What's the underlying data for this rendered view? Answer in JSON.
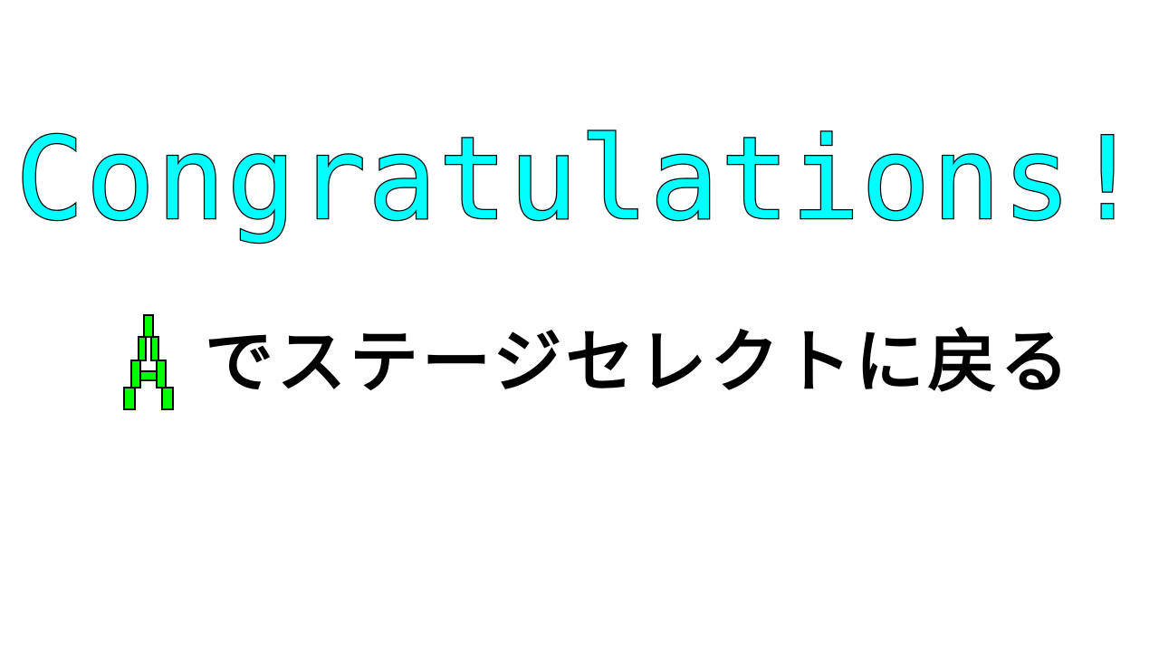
{
  "title": {
    "text": "Congratulations!",
    "color": "#00ffff",
    "outline_color": "#000000"
  },
  "prompt": {
    "button_icon": "a-button-icon",
    "button_icon_color": "#00ff00",
    "text": "でステージセレクトに戻る",
    "text_color": "#000000"
  },
  "background_color": "#ffffff"
}
